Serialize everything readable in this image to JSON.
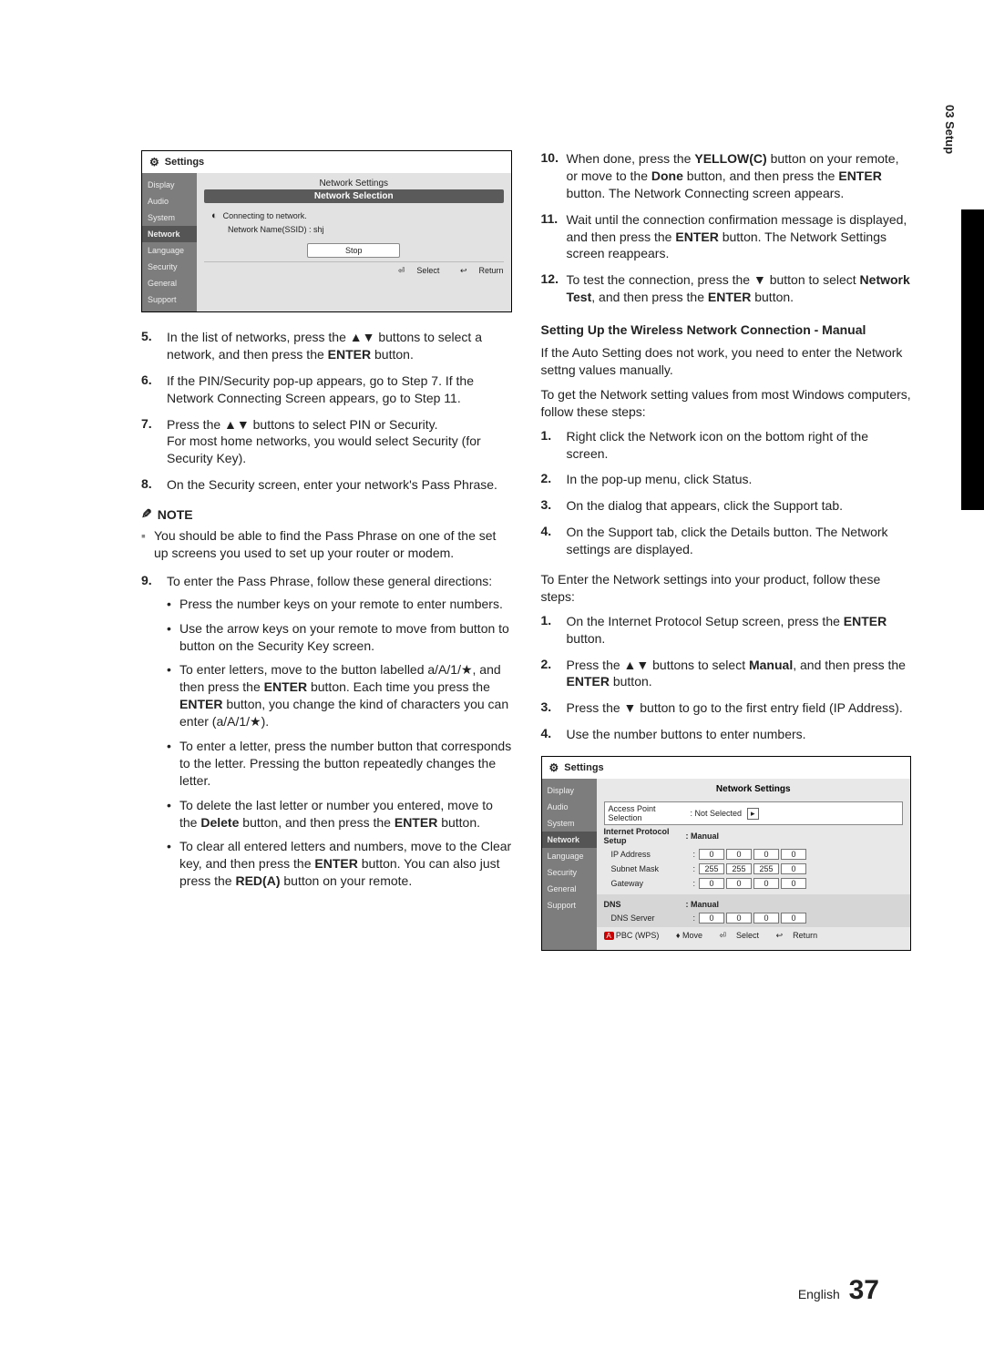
{
  "sideTab": "03  Setup",
  "osd1": {
    "title": "Settings",
    "sidebar": [
      "Display",
      "Audio",
      "System",
      "Network",
      "Language",
      "Security",
      "General",
      "Support"
    ],
    "headerSmall": "Network Settings",
    "headerBar": "Network Selection",
    "connecting": "Connecting to network.",
    "ssid": "Network Name(SSID) : shj",
    "stopBtn": "Stop",
    "footSelect": "Select",
    "footReturn": "Return"
  },
  "leftSteps": {
    "s5": "In the list of networks, press the ▲▼ buttons to select a network, and then press the <b>ENTER</b> button.",
    "s6": "If the PIN/Security pop-up appears, go to Step 7. If the Network Connecting Screen appears, go to Step 11.",
    "s7": "Press the ▲▼ buttons to select PIN or Security.<br>For most home networks, you would select Security (for Security Key).",
    "s8": "On the Security screen, enter your network's Pass Phrase.",
    "noteLabel": "NOTE",
    "noteBody": "You should be able to find the Pass Phrase on one of the set up screens you used to set up your router or modem.",
    "s9intro": "To enter the Pass Phrase, follow these general directions:",
    "s9bullets": [
      "Press the number keys on your remote to enter numbers.",
      "Use the arrow keys on your remote to move from button to button on the Security Key screen.",
      "To enter letters, move to the button labelled a/A/1/★, and then press the <b>ENTER</b> button. Each time you press the <b>ENTER</b> button, you change the kind of characters you can enter (a/A/1/★).",
      "To enter a letter, press the number button that corresponds to the letter. Pressing the button repeatedly changes the letter.",
      "To delete the last letter or number you entered, move to the <b>Delete</b> button, and then press the <b>ENTER</b> button.",
      "To clear all entered letters and numbers, move to the Clear key, and then press the <b>ENTER</b> button. You can also just press the <b>RED(A)</b> button on your remote."
    ]
  },
  "rightSteps": {
    "s10": "When done, press the <b>YELLOW(C)</b> button on your remote, or move to the <b>Done</b> button, and then press the <b>ENTER</b> button. The Network Connecting screen appears.",
    "s11": "Wait until the connection confirmation message is displayed, and then press the <b>ENTER</b> button. The Network Settings screen reappears.",
    "s12": "To test the connection, press the ▼ button to select <b>Network Test</b>, and then press the <b>ENTER</b> button.",
    "h4": "Setting Up the Wireless Network Connection - Manual",
    "p1": "If the Auto Setting does not work, you need to enter the Network settng values manually.",
    "p2": "To get the Network setting values from most Windows computers, follow these steps:",
    "a1": "Right click the Network icon on the bottom right of the screen.",
    "a2": "In the pop-up menu, click Status.",
    "a3": "On the dialog that appears, click the Support tab.",
    "a4": "On the Support tab, click the Details button. The Network settings are displayed.",
    "p3": "To Enter the Network settings into your product, follow these steps:",
    "b1": "On the Internet Protocol Setup screen, press the <b>ENTER</b> button.",
    "b2": "Press the ▲▼ buttons to select <b>Manual</b>, and then press the <b>ENTER</b> button.",
    "b3": "Press the ▼ button to go to the first entry field (IP Address).",
    "b4": "Use the number buttons to enter numbers."
  },
  "osd2": {
    "title": "Settings",
    "sidebar": [
      "Display",
      "Audio",
      "System",
      "Network",
      "Language",
      "Security",
      "General",
      "Support"
    ],
    "header": "Network Settings",
    "apsLabel": "Access Point Selection",
    "apsValue": ": Not Selected",
    "ipsLabel": "Internet Protocol Setup",
    "ipsValue": ": Manual",
    "ipAddrLabel": "IP Address",
    "ip": [
      "0",
      "0",
      "0",
      "0"
    ],
    "subnetLabel": "Subnet Mask",
    "subnet": [
      "255",
      "255",
      "255",
      "0"
    ],
    "gatewayLabel": "Gateway",
    "gateway": [
      "0",
      "0",
      "0",
      "0"
    ],
    "dnsLabel": "DNS",
    "dnsValue": ": Manual",
    "dnsServerLabel": "DNS Server",
    "dnsServer": [
      "0",
      "0",
      "0",
      "0"
    ],
    "foot": {
      "a": "A",
      "pbc": "PBC (WPS)",
      "move": "Move",
      "select": "Select",
      "return": "Return"
    }
  },
  "footer": {
    "lang": "English",
    "page": "37"
  },
  "nums": {
    "n5": "5.",
    "n6": "6.",
    "n7": "7.",
    "n8": "8.",
    "n9": "9.",
    "n10": "10.",
    "n11": "11.",
    "n12": "12.",
    "n1": "1.",
    "n2": "2.",
    "n3": "3.",
    "n4": "4."
  }
}
